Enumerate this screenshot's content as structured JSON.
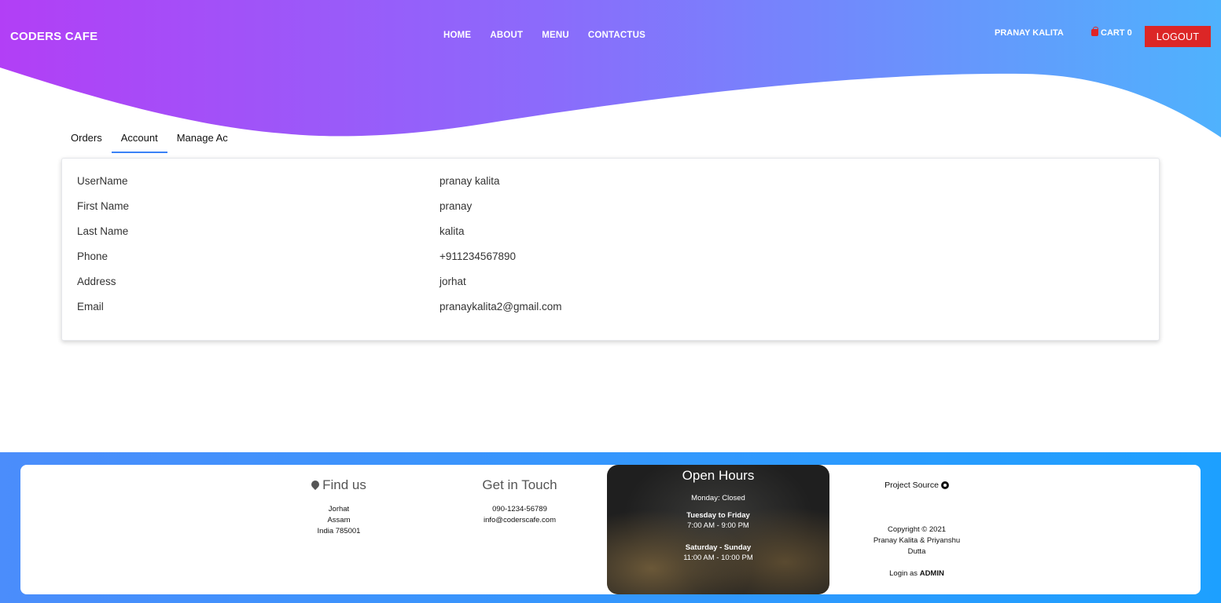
{
  "header": {
    "brand": "CODERS CAFE",
    "nav": [
      "HOME",
      "ABOUT",
      "MENU",
      "CONTACTUS"
    ],
    "user": "PRANAY KALITA",
    "cart_label": "CART 0",
    "logout_label": "LOGOUT",
    "gradient_colors": [
      "#b23ff6",
      "#8b6bfb",
      "#4fb2fd"
    ]
  },
  "tabs": [
    {
      "label": "Orders",
      "active": false
    },
    {
      "label": "Account",
      "active": true
    },
    {
      "label": "Manage Ac",
      "active": false
    }
  ],
  "account": {
    "rows": [
      {
        "key": "UserName",
        "value": "pranay kalita"
      },
      {
        "key": "First Name",
        "value": "pranay"
      },
      {
        "key": "Last Name",
        "value": "kalita"
      },
      {
        "key": "Phone",
        "value": "+911234567890"
      },
      {
        "key": "Address",
        "value": "jorhat"
      },
      {
        "key": "Email",
        "value": "pranaykalita2@gmail.com"
      }
    ]
  },
  "footer": {
    "find_us": {
      "title": "Find us",
      "lines": [
        "Jorhat",
        "Assam",
        "India 785001"
      ]
    },
    "get_in_touch": {
      "title": "Get in Touch",
      "phone": "090-1234-56789",
      "email": "info@coderscafe.com"
    },
    "open_hours": {
      "title": "Open Hours",
      "monday": "Monday: Closed",
      "weekday_label": "Tuesday to Friday",
      "weekday_hours": "7:00 AM - 9:00 PM",
      "weekend_label": "Saturday - Sunday",
      "weekend_hours": "11:00 AM - 10:00 PM"
    },
    "project_source": "Project Source",
    "copyright_lines": [
      "Copyright © 2021",
      "Pranay Kalita & Priyanshu",
      "Dutta"
    ],
    "login_as_prefix": "Login as",
    "login_as_role": "ADMIN"
  }
}
